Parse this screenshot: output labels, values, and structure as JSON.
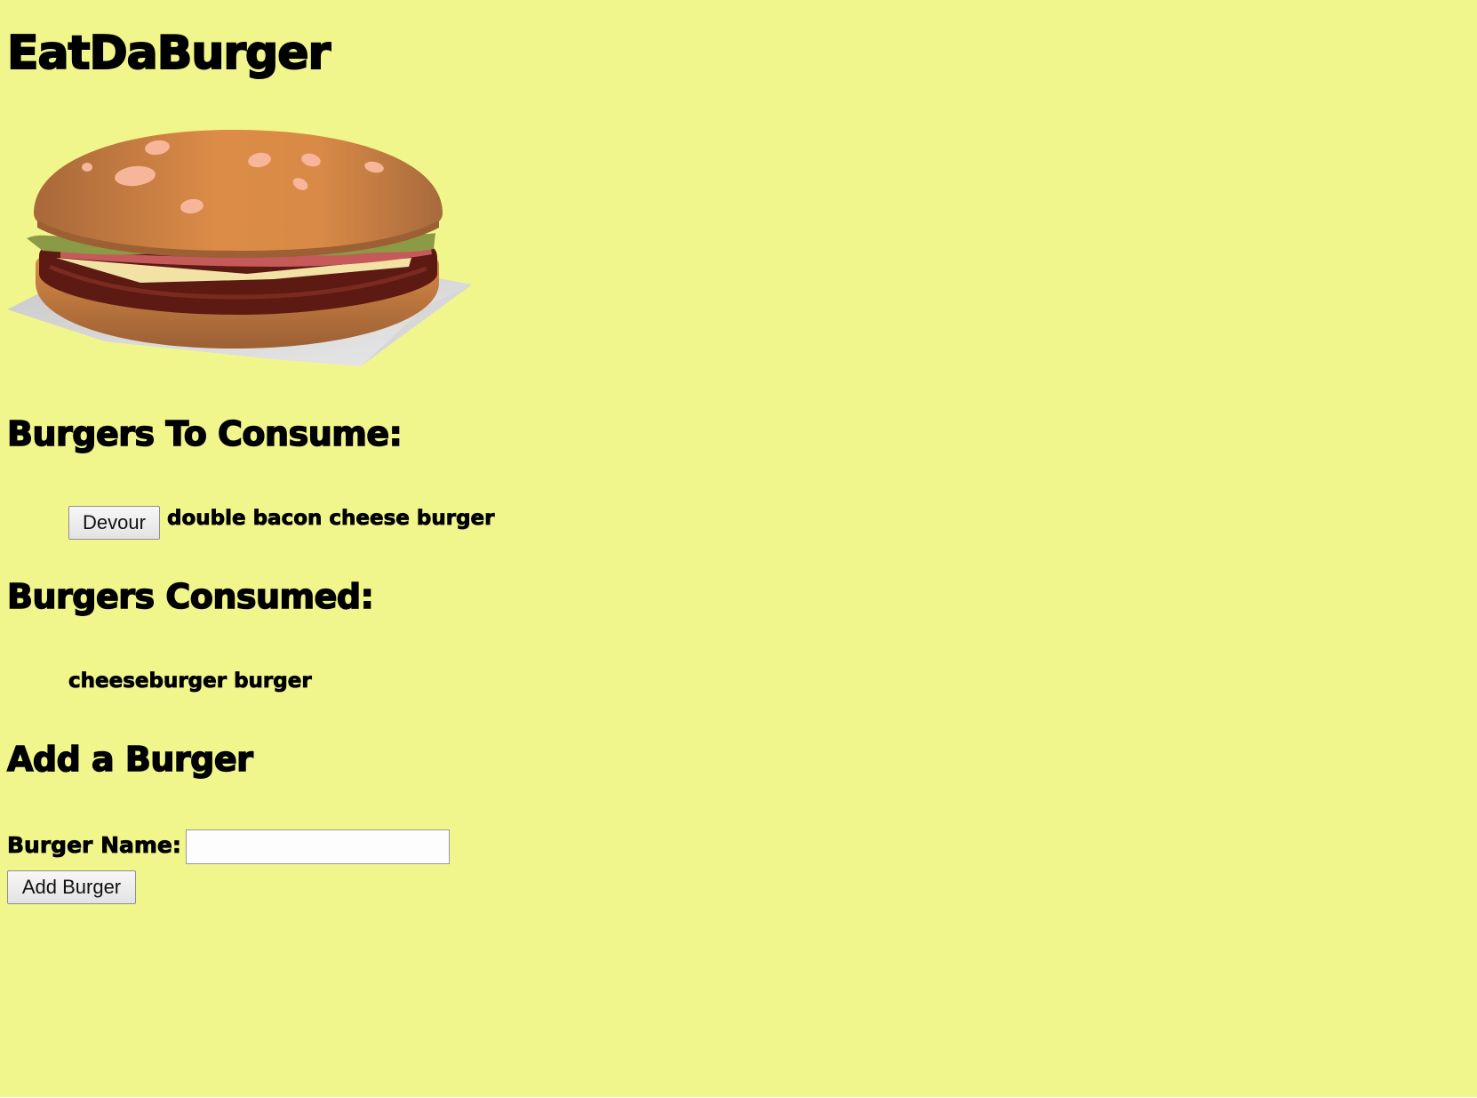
{
  "page": {
    "background": "#f1f68c"
  },
  "header": {
    "title": "EatDaBurger",
    "logo": "burger-illustration"
  },
  "to_consume": {
    "heading": "Burgers To Consume:",
    "items": [
      {
        "button_label": "Devour",
        "name": "double bacon cheese burger"
      }
    ]
  },
  "consumed": {
    "heading": "Burgers Consumed:",
    "items": [
      {
        "name": "cheeseburger burger"
      }
    ]
  },
  "add_form": {
    "heading": "Add a Burger",
    "field_label": "Burger Name:",
    "field_value": "",
    "submit_label": "Add Burger"
  }
}
